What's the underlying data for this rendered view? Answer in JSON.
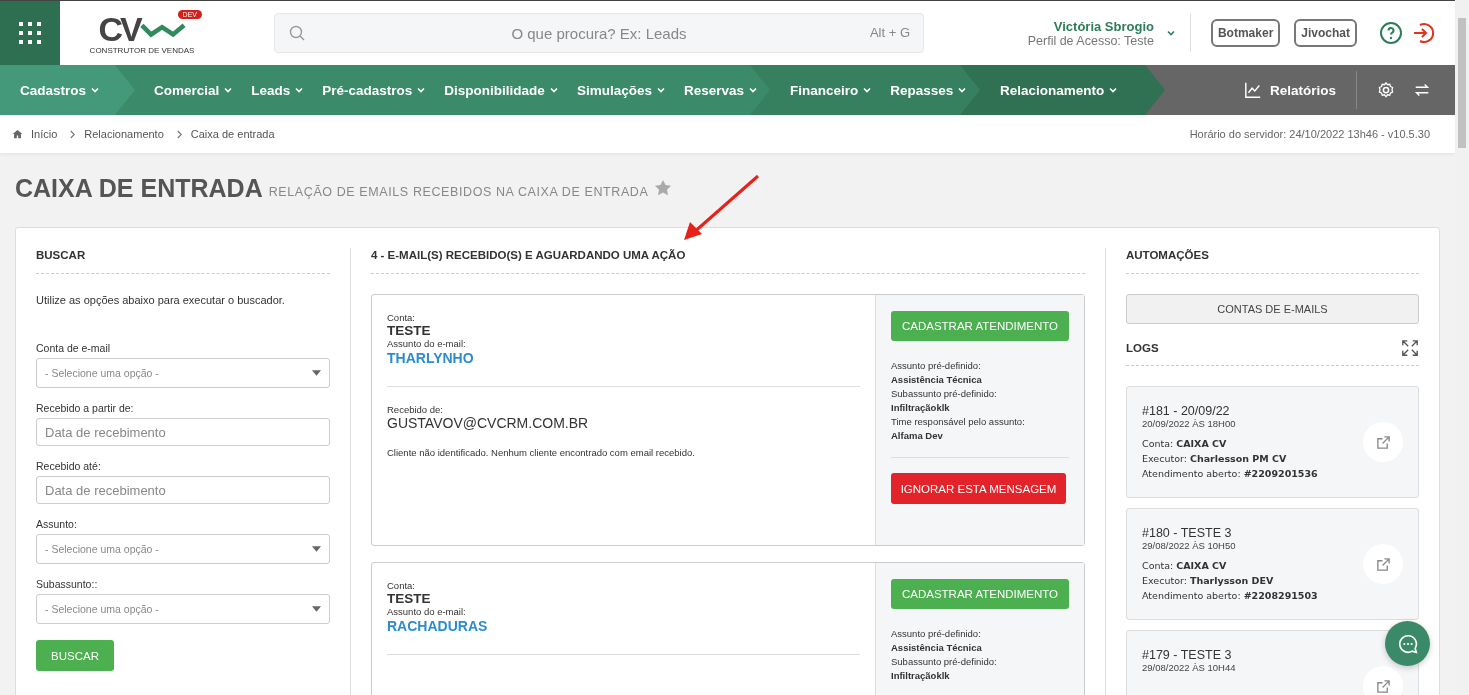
{
  "header": {
    "logo": {
      "text": "CV",
      "badge": "DEV",
      "tagline": "CONSTRUTOR DE VENDAS"
    },
    "search": {
      "placeholder": "O que procura? Ex: Leads",
      "shortcut": "Alt + G"
    },
    "user": {
      "name": "Victória Sbrogio",
      "profile": "Perfil de Acesso: Teste"
    },
    "buttons": [
      "Botmaker",
      "Jivochat"
    ]
  },
  "nav": {
    "groups": [
      {
        "color": "#43997a",
        "items": [
          "Cadastros"
        ]
      },
      {
        "color": "#3b8a69",
        "items": [
          "Comercial",
          "Leads",
          "Pré-cadastros",
          "Disponibilidade",
          "Simulações",
          "Reservas"
        ]
      },
      {
        "color": "#37805f",
        "items": [
          "Financeiro",
          "Repasses"
        ]
      },
      {
        "color": "#2f7152",
        "items": [
          "Relacionamento"
        ]
      }
    ],
    "reports": "Relatórios"
  },
  "breadcrumb": [
    "Início",
    "Relacionamento",
    "Caixa de entrada"
  ],
  "server_time": "Horário do servidor: 24/10/2022 13h46 - v10.5.30",
  "page": {
    "title": "CAIXA DE ENTRADA",
    "subtitle": "RELAÇÃO DE EMAILS RECEBIDOS NA CAIXA DE ENTRADA",
    "favorite": false
  },
  "search_panel": {
    "heading": "BUSCAR",
    "hint": "Utilize as opções abaixo para executar o buscador.",
    "fields": [
      {
        "label": "Conta de e-mail",
        "kind": "select",
        "placeholder": "- Selecione uma opção -"
      },
      {
        "label": "Recebido a partir de:",
        "kind": "date",
        "placeholder": "Data de recebimento"
      },
      {
        "label": "Recebido até:",
        "kind": "date",
        "placeholder": "Data de recebimento"
      },
      {
        "label": "Assunto:",
        "kind": "select",
        "placeholder": "- Selecione uma opção -"
      },
      {
        "label": "Subassunto::",
        "kind": "select",
        "placeholder": "- Selecione uma opção -"
      }
    ],
    "button": "BUSCAR"
  },
  "emails": {
    "heading": "4 - E-MAIL(S) RECEBIDO(S) E AGUARDANDO UMA AÇÃO",
    "items": [
      {
        "account_label": "Conta:",
        "account": "TESTE",
        "subject_label": "Assunto do e-mail:",
        "subject": "THARLYNHO",
        "sender_label": "Recebido de:",
        "sender": "GUSTAVOV@CVCRM.COM.BR",
        "note": "Cliente não identificado. Nenhum cliente encontrado com email recebido.",
        "action_button": "CADASTRAR ATENDIMENTO",
        "predefined": [
          {
            "label": "Assunto pré-definido:",
            "value": "Assistência Técnica"
          },
          {
            "label": "Subassunto pré-definido:",
            "value": "Infiltraçãoklk"
          },
          {
            "label": "Time responsável pelo assunto:",
            "value": "Alfama Dev"
          }
        ],
        "ignore_button": "IGNORAR ESTA MENSAGEM"
      },
      {
        "account_label": "Conta:",
        "account": "TESTE",
        "subject_label": "Assunto do e-mail:",
        "subject": "RACHADURAS",
        "action_button": "CADASTRAR ATENDIMENTO",
        "predefined": [
          {
            "label": "Assunto pré-definido:",
            "value": "Assistência Técnica"
          },
          {
            "label": "Subassunto pré-definido:",
            "value": "Infiltraçãoklk"
          }
        ]
      }
    ]
  },
  "automations": {
    "heading": "AUTOMAÇÕES",
    "accounts_button": "CONTAS DE E-MAILS",
    "logs_heading": "LOGS",
    "logs": [
      {
        "title": "#181 - 20/09/22",
        "date": "20/09/2022 ÀS 18H00",
        "rows": [
          {
            "label": "Conta:",
            "value": "CAIXA CV"
          },
          {
            "label": "Executor:",
            "value": "Charlesson PM CV"
          },
          {
            "label": "Atendimento aberto:",
            "value": "#2209201536"
          }
        ]
      },
      {
        "title": "#180 - TESTE 3",
        "date": "29/08/2022 ÀS 10H50",
        "rows": [
          {
            "label": "Conta:",
            "value": "CAIXA CV"
          },
          {
            "label": "Executor:",
            "value": "Tharlysson DEV"
          },
          {
            "label": "Atendimento aberto:",
            "value": "#2208291503"
          }
        ]
      },
      {
        "title": "#179 - TESTE 3",
        "date": "29/08/2022 ÀS 10H44"
      }
    ]
  }
}
